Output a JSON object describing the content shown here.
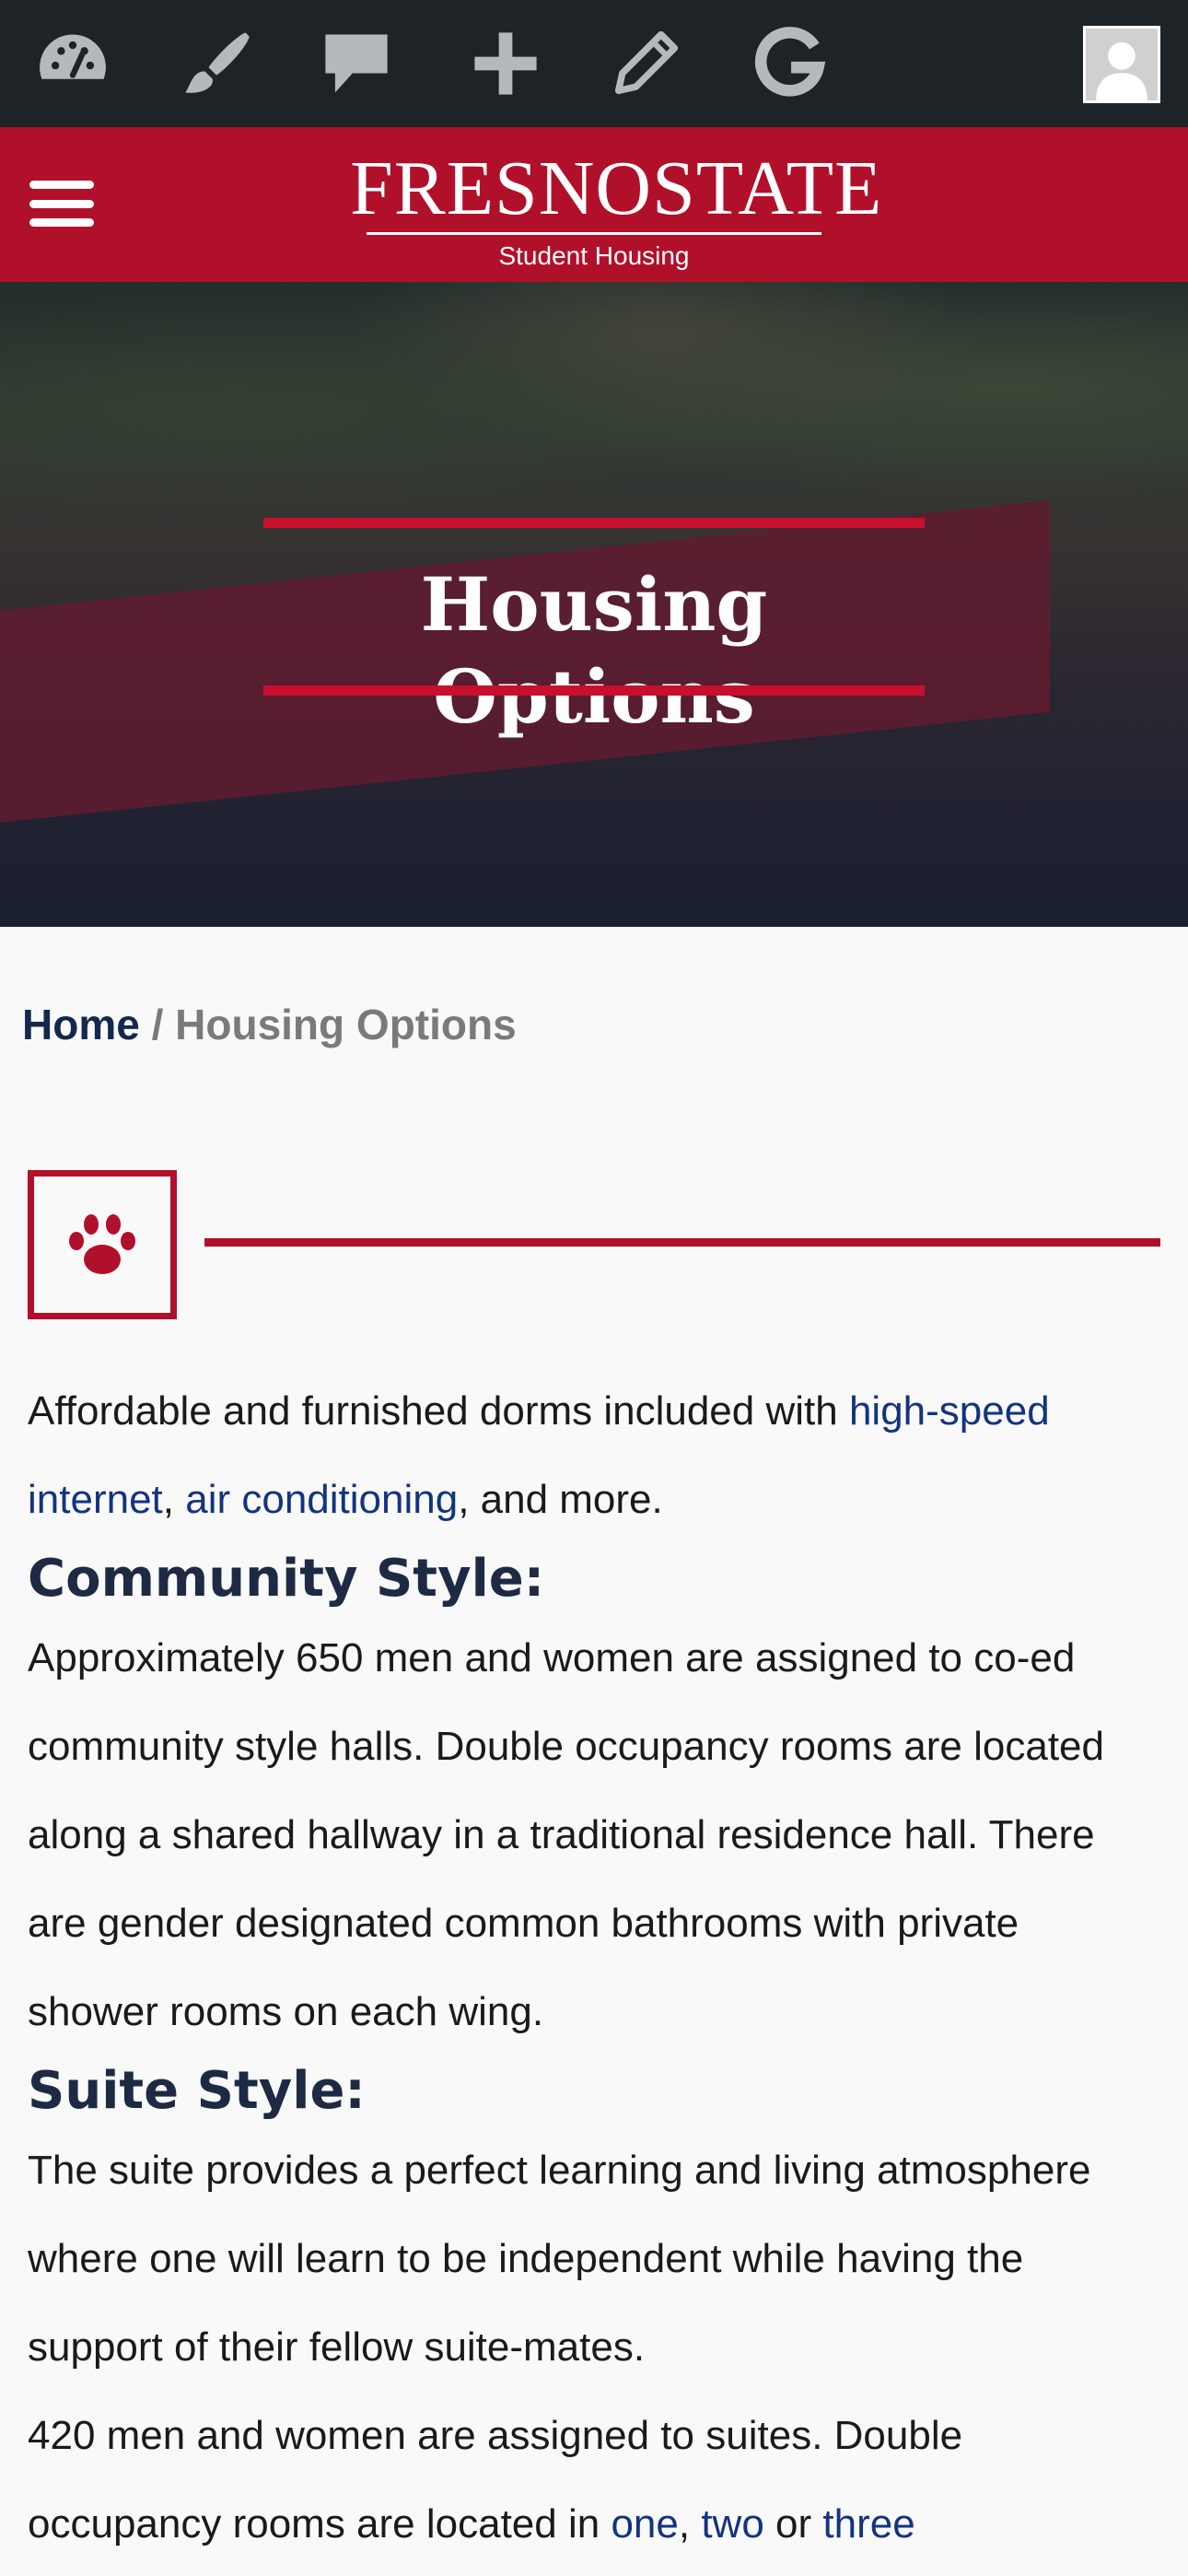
{
  "admin_bar": {
    "icons": [
      "dashboard-icon",
      "brush-icon",
      "comment-icon",
      "plus-icon",
      "pencil-icon",
      "google-icon"
    ],
    "avatar": "user-avatar-icon"
  },
  "header": {
    "menu_icon": "hamburger-icon",
    "logo_main": "FRESNOSTATE",
    "logo_sub": "Student Housing",
    "brand_color": "#b1102b"
  },
  "hero": {
    "title": "Housing Options"
  },
  "breadcrumb": {
    "home": "Home",
    "separator": "/",
    "current": "Housing Options"
  },
  "divider": {
    "icon": "paw-icon"
  },
  "intro": {
    "text_before": "Affordable and furnished dorms included with ",
    "link_internet": "high-speed internet",
    "comma": ", ",
    "link_ac": "air conditioning",
    "text_after": ", and more."
  },
  "community": {
    "heading": "Community Style:",
    "body": "Approximately 650 men and women are assigned to co-ed community style halls. Double occupancy rooms are located along a shared hallway in a traditional residence hall. There are gender designated common bathrooms with private shower rooms on each wing."
  },
  "suite": {
    "heading": "Suite Style:",
    "body": "The suite provides a perfect learning and living atmosphere where one will learn to be independent while having the support of their fellow suite-mates.",
    "body2_before": "420 men and women are assigned to suites. Double occupancy rooms are located in ",
    "link_one": "one",
    "sep1": ", ",
    "link_two": "two",
    "sep2": " or ",
    "link_three": "three"
  }
}
